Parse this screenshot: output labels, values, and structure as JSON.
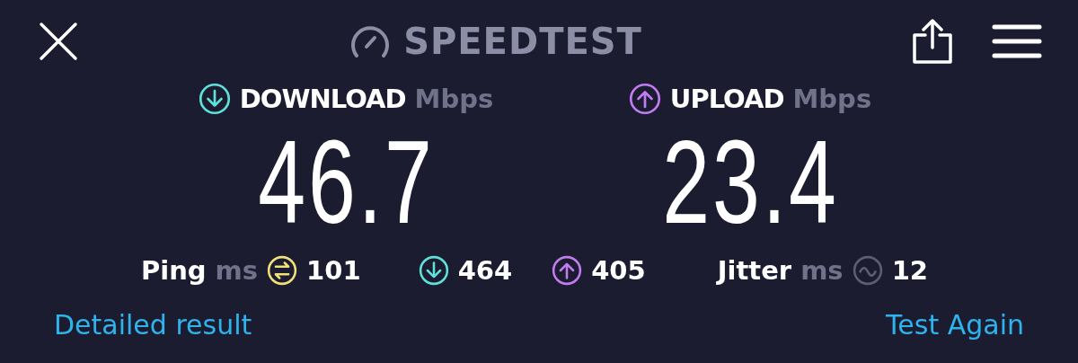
{
  "header": {
    "title": "SPEEDTEST"
  },
  "speeds": [
    {
      "kind": "download",
      "label": "DOWNLOAD",
      "unit": "Mbps",
      "value": "46.7"
    },
    {
      "kind": "upload",
      "label": "UPLOAD",
      "unit": "Mbps",
      "value": "23.4"
    }
  ],
  "stats": [
    {
      "kind": "ping",
      "label": "Ping",
      "unit": "ms",
      "value": "101"
    },
    {
      "kind": "download",
      "value": "464"
    },
    {
      "kind": "upload",
      "value": "405"
    },
    {
      "kind": "jitter",
      "label": "Jitter",
      "unit": "ms",
      "value": "12"
    }
  ],
  "links": [
    "Detailed result",
    "Test Again"
  ]
}
